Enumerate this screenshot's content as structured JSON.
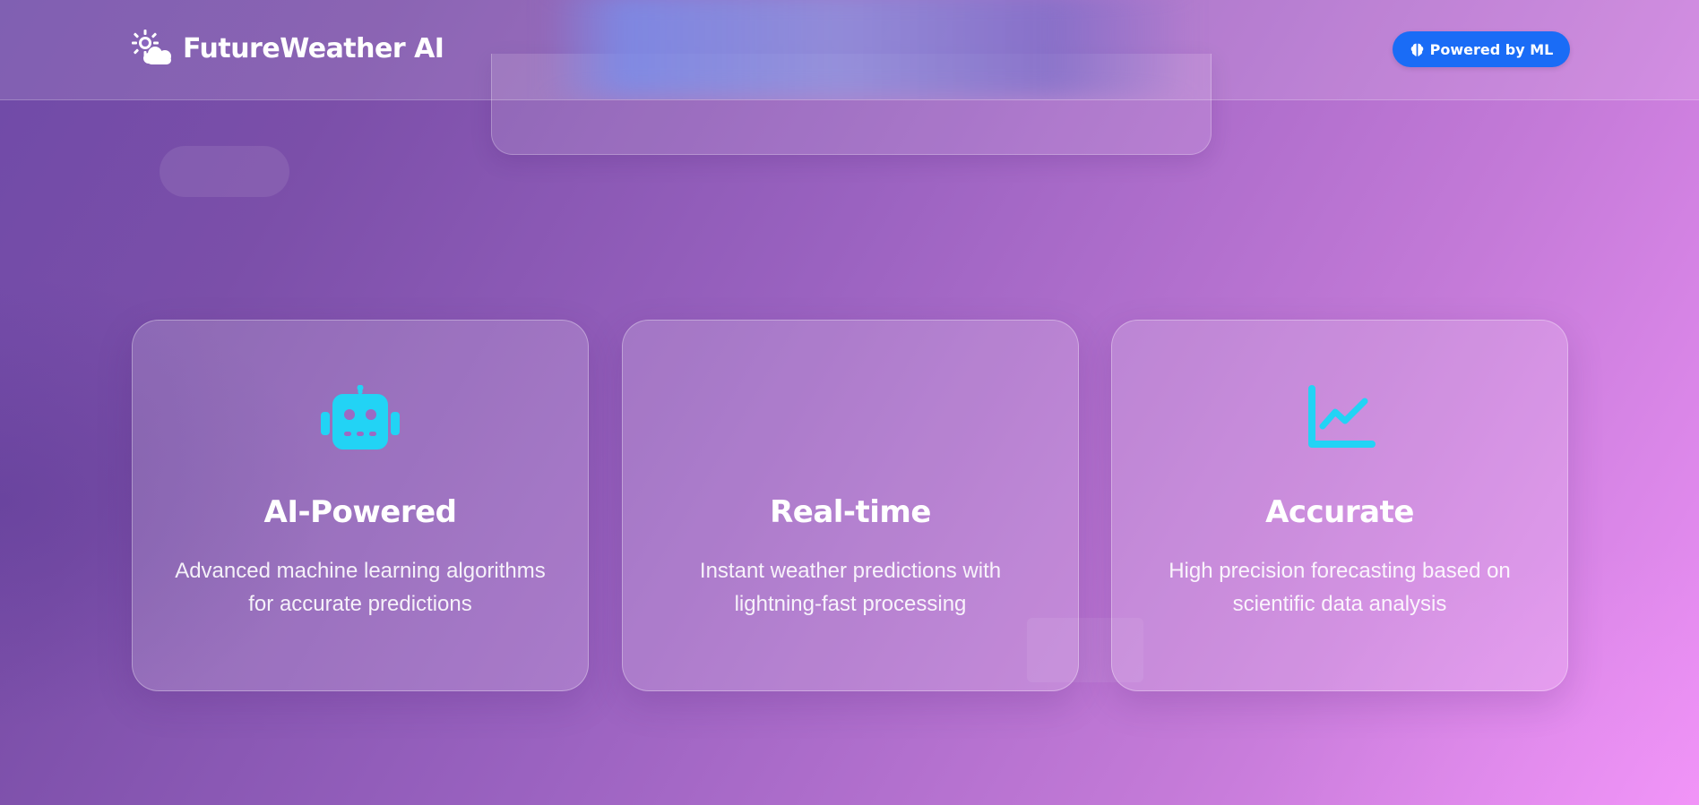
{
  "header": {
    "brand_icon": "sun-behind-cloud-icon",
    "brand_title": "FutureWeather AI",
    "badge_icon": "brain-icon",
    "badge_label": "Powered by ML"
  },
  "features": [
    {
      "icon": "robot-icon",
      "title": "AI-Powered",
      "description": "Advanced machine learning algorithms for accurate predictions"
    },
    {
      "icon": "none",
      "title": "Real-time",
      "description": "Instant weather predictions with lightning-fast processing"
    },
    {
      "icon": "chart-line-icon",
      "title": "Accurate",
      "description": "High precision forecasting based on scientific data analysis"
    }
  ],
  "colors": {
    "accent_icon": "#22d3f5",
    "badge_bg": "#1a6cf6",
    "text": "#ffffff"
  }
}
